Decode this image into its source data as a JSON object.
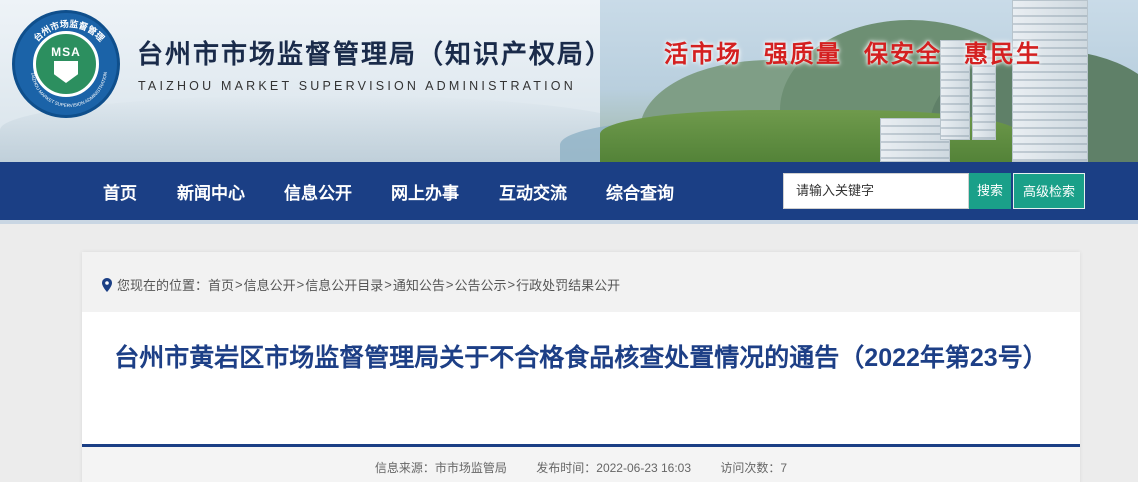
{
  "header": {
    "title": "台州市市场监督管理局（知识产权局）",
    "subtitle": "TAIZHOU MARKET SUPERVISION ADMINISTRATION",
    "logo_text": "MSA",
    "logo_ring_text": "台州市场监督管理",
    "logo_ring_text_en": "TAIZHOU MARKET SUPERVISION ADMINISTRATION",
    "slogans": [
      "活市场",
      "强质量",
      "保安全",
      "惠民生"
    ]
  },
  "nav": {
    "items": [
      "首页",
      "新闻中心",
      "信息公开",
      "网上办事",
      "互动交流",
      "综合查询"
    ]
  },
  "search": {
    "placeholder": "请输入关键字",
    "button_label": "搜索",
    "advanced_label": "高级检索"
  },
  "breadcrumb": {
    "prefix": "您现在的位置：",
    "items": [
      "首页",
      "信息公开",
      "信息公开目录",
      "通知公告",
      "公告公示",
      "行政处罚结果公开"
    ],
    "separator": ">"
  },
  "article": {
    "title": "台州市黄岩区市场监督管理局关于不合格食品核查处置情况的通告（2022年第23号）",
    "source": "信息来源：市市场监管局",
    "published": "发布时间：2022-06-23 16:03",
    "visits": "访问次数：7"
  },
  "colors": {
    "nav_bg": "#1b3f85",
    "title_color": "#1d3f86",
    "slogan_red": "#d42020",
    "search_button": "#1aa089"
  }
}
